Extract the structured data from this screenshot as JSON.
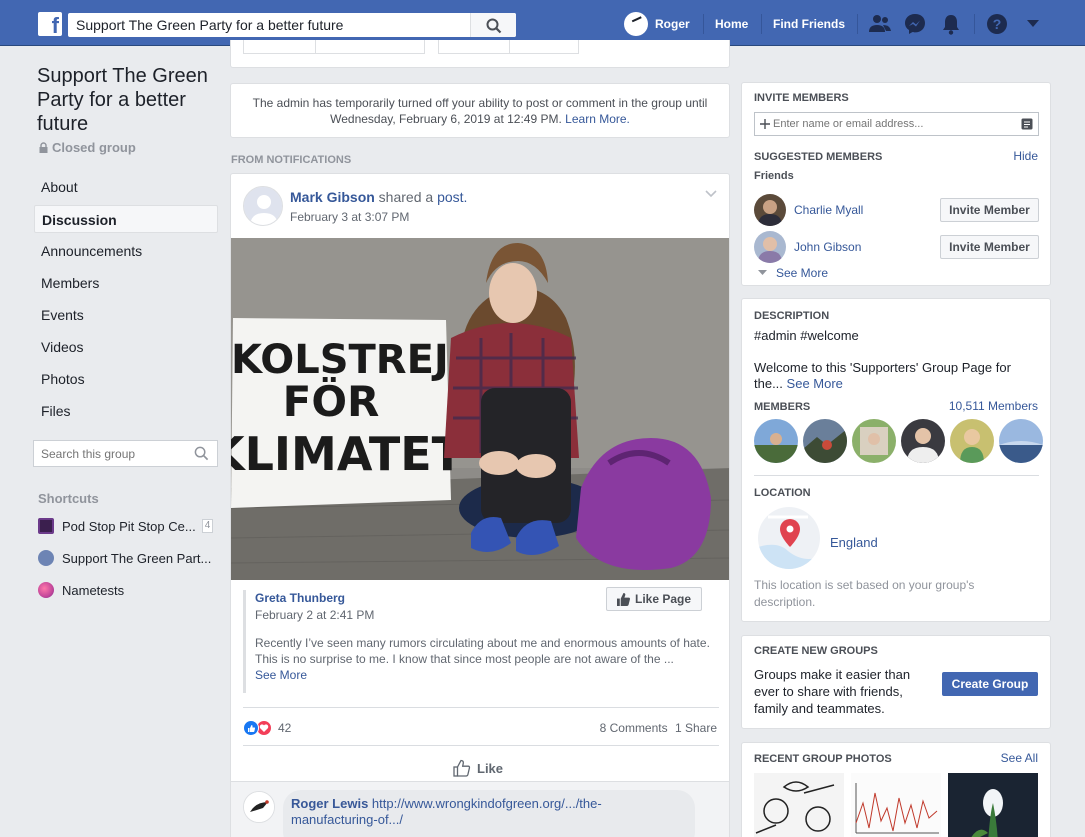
{
  "topbar": {
    "search_value": "Support The Green Party for a better future",
    "profile_name": "Roger",
    "home": "Home",
    "find_friends": "Find Friends",
    "icons": [
      "friends-icon",
      "messenger-icon",
      "bell-icon",
      "help-icon",
      "caret-down-icon"
    ]
  },
  "sidebar": {
    "group_name": "Support The Green Party for a better future",
    "privacy": "Closed group",
    "nav": [
      "About",
      "Discussion",
      "Announcements",
      "Members",
      "Events",
      "Videos",
      "Photos",
      "Files"
    ],
    "active_nav": "Discussion",
    "search_placeholder": "Search this group",
    "shortcuts_title": "Shortcuts",
    "shortcuts": [
      {
        "label": "Pod Stop Pit Stop Ce...",
        "badge": "4"
      },
      {
        "label": "Support The Green Part..."
      },
      {
        "label": "Nametests"
      }
    ]
  },
  "notice": {
    "text": "The admin has temporarily turned off your ability to post or comment in the group until Wednesday, February 6, 2019 at 12:49 PM.",
    "link": "Learn More."
  },
  "feed": {
    "section_label": "FROM NOTIFICATIONS",
    "post": {
      "author": "Mark Gibson",
      "action": " shared a ",
      "object": "post.",
      "date": "February 3 at 3:07 PM",
      "sign_text": [
        "SKOLSTREJK",
        "FÖR",
        "KLIMATET"
      ],
      "shared_author": "Greta Thunberg",
      "shared_date": "February 2 at 2:41 PM",
      "like_page": "Like Page",
      "shared_text": "Recently I’ve seen many rumors circulating about me and enormous amounts of hate. This is no surprise to me. I know that since most people are not aware of the ...",
      "see_more": "See More",
      "reaction_count": "42",
      "comments": "8 Comments",
      "shares": "1 Share",
      "like_label": "Like",
      "comment_author": "Roger Lewis",
      "comment_link": "http://www.wrongkindofgreen.org/.../the-manufacturing-of.../"
    }
  },
  "invite": {
    "title": "INVITE MEMBERS",
    "input_placeholder": "Enter name or email address...",
    "suggested_title": "SUGGESTED MEMBERS",
    "hide": "Hide",
    "friends_label": "Friends",
    "people": [
      {
        "name": "Charlie Myall",
        "button": "Invite Member"
      },
      {
        "name": "John Gibson",
        "button": "Invite Member"
      }
    ],
    "see_more": "See More"
  },
  "description": {
    "title": "DESCRIPTION",
    "tags": "#admin #welcome",
    "text": "Welcome to this 'Supporters' Group Page for the...",
    "see_more": "See More",
    "members_title": "MEMBERS",
    "members_count": "10,511 Members",
    "location_title": "LOCATION",
    "location": "England",
    "location_note": "This location is set based on your group's description."
  },
  "create_groups": {
    "title": "CREATE NEW GROUPS",
    "text": "Groups make it easier than ever to share with friends, family and teammates.",
    "button": "Create Group"
  },
  "recent_photos": {
    "title": "RECENT GROUP PHOTOS",
    "see_all": "See All"
  },
  "colors": {
    "brand": "#4267b2",
    "link": "#365899",
    "background": "#e9ebee",
    "like_blue": "#1877f2",
    "love_red": "#f33e58"
  }
}
